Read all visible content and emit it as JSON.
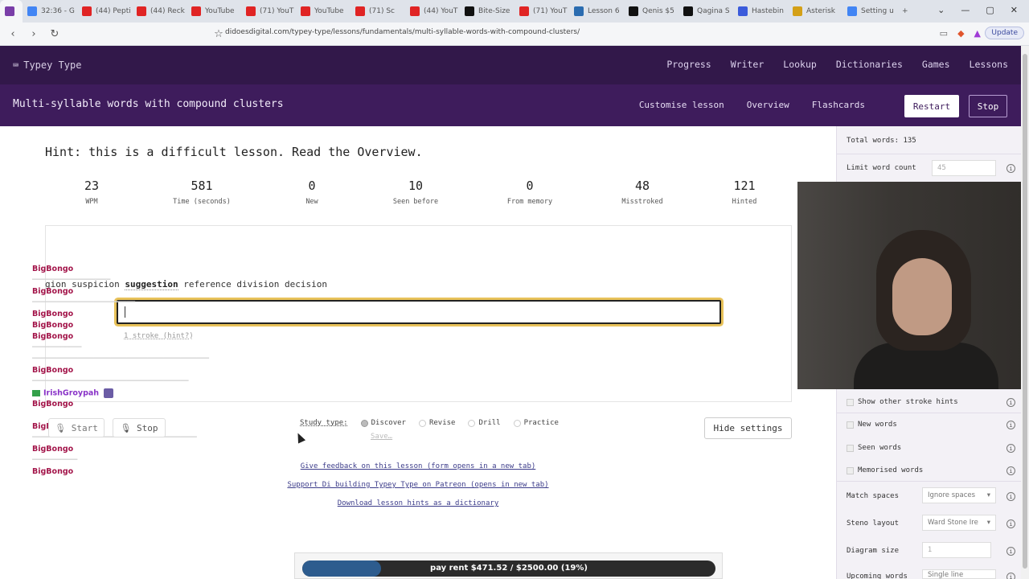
{
  "browser": {
    "tabs": [
      {
        "label": "",
        "color": "#7a3ea8"
      },
      {
        "label": "32:36 - G",
        "color": "#4285f4"
      },
      {
        "label": "(44) Pepti",
        "color": "#e02424"
      },
      {
        "label": "(44) Reck",
        "color": "#e02424"
      },
      {
        "label": "YouTube",
        "color": "#e02424"
      },
      {
        "label": "(71) YouT",
        "color": "#e02424"
      },
      {
        "label": "YouTube",
        "color": "#e02424"
      },
      {
        "label": "(71) Sc",
        "color": "#e02424"
      },
      {
        "label": "(44) YouT",
        "color": "#e02424"
      },
      {
        "label": "Bite-Size",
        "color": "#111111"
      },
      {
        "label": "(71) YouT",
        "color": "#e02424"
      },
      {
        "label": "Lesson 6",
        "color": "#2b6cb0"
      },
      {
        "label": "Qenis $5",
        "color": "#111111"
      },
      {
        "label": "Qagina S",
        "color": "#111111"
      },
      {
        "label": "Hastebin",
        "color": "#3b5bdb"
      },
      {
        "label": "Asterisk",
        "color": "#d4a017"
      },
      {
        "label": "Setting u",
        "color": "#4285f4"
      }
    ],
    "new_tab": "+",
    "url": "didoesdigital.com/typey-type/lessons/fundamentals/multi-syllable-words-with-compound-clusters/",
    "update_label": "Update"
  },
  "app": {
    "logo": "Typey Type",
    "nav": [
      "Progress",
      "Writer",
      "Lookup",
      "Dictionaries",
      "Games",
      "Lessons"
    ]
  },
  "lesson": {
    "title": "Multi-syllable words with compound clusters",
    "links": [
      "Customise lesson",
      "Overview",
      "Flashcards"
    ],
    "restart": "Restart",
    "stop": "Stop",
    "hint": "Hint: this is a difficult lesson. Read the Overview.",
    "stats": [
      {
        "value": "23",
        "label": "WPM"
      },
      {
        "value": "581",
        "label": "Time (seconds)"
      },
      {
        "value": "0",
        "label": "New"
      },
      {
        "value": "10",
        "label": "Seen before"
      },
      {
        "value": "0",
        "label": "From memory"
      },
      {
        "value": "48",
        "label": "Misstroked"
      },
      {
        "value": "121",
        "label": "Hinted"
      }
    ],
    "words_before": "gion suspicion ",
    "current_word": "suggestion",
    "words_after": " reference division decision",
    "stroke_hint": "1 stroke (hint?)",
    "start": "Start",
    "stop_btn": "Stop",
    "study_type_label": "Study type:",
    "study_types": [
      "Discover",
      "Revise",
      "Drill",
      "Practice"
    ],
    "save": "Save…",
    "hide_settings": "Hide settings",
    "footer_links": [
      "Give feedback on this lesson (form opens in a new tab)",
      "Support Di building Typey Type on Patreon (opens in new tab)",
      "Download lesson hints as a dictionary"
    ]
  },
  "chat": {
    "rows": [
      {
        "user": "BigBongo"
      },
      {
        "user": "BigBongo"
      },
      {
        "user": "BigBongo"
      },
      {
        "user": "BigBongo"
      },
      {
        "user": "BigBongo"
      },
      {
        "user": "BigBongo"
      },
      {
        "user": "IrishGroypah"
      },
      {
        "user": "BigBongo"
      },
      {
        "user": "BigBongo"
      },
      {
        "user": "BigBongo"
      },
      {
        "user": "BigBongo"
      }
    ]
  },
  "settings": {
    "total_words": "Total words: 135",
    "limit_word_count": "Limit word count",
    "limit_value": "45",
    "show_other_hints": "Show other stroke hints",
    "new_words": "New words",
    "seen_words": "Seen words",
    "memorised_words": "Memorised words",
    "match_spaces": "Match spaces",
    "match_spaces_value": "Ignore spaces",
    "steno_layout": "Steno layout",
    "steno_layout_value": "Ward Stone Ire",
    "diagram_size": "Diagram size",
    "diagram_value": "1",
    "upcoming_words": "Upcoming words",
    "upcoming_value": "Single line"
  },
  "donation": {
    "text": "pay rent $471.52 / $2500.00 (19%)",
    "progress": 0.19,
    "fill_color": "#2d5c8e"
  },
  "colors": {
    "header": "#32184a",
    "lesson_bar": "#3e1c5c",
    "chat_user": "#a3154a"
  }
}
